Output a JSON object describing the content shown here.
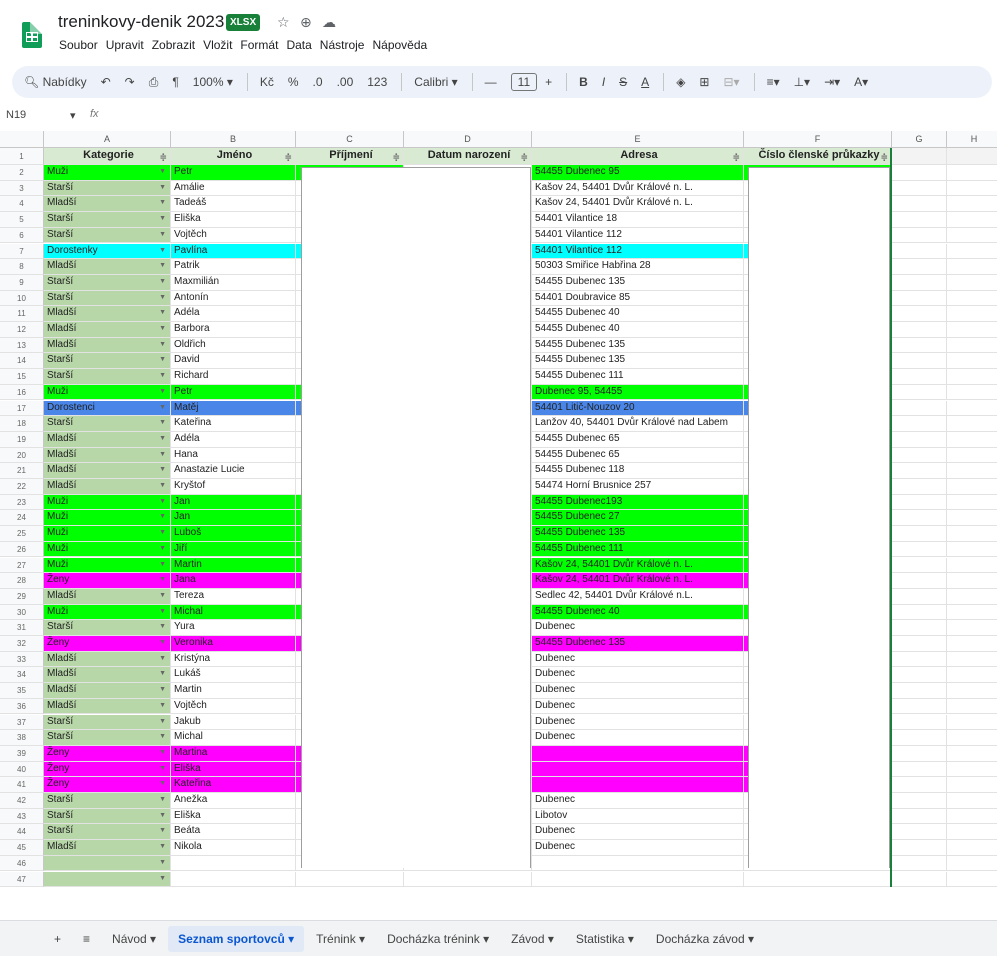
{
  "doc": {
    "title": "treninkovy-denik 2023",
    "badge": "XLSX",
    "menu": [
      "Soubor",
      "Upravit",
      "Zobrazit",
      "Vložit",
      "Formát",
      "Data",
      "Nástroje",
      "Nápověda"
    ]
  },
  "toolbar": {
    "search": "Nabídky",
    "zoom": "100% ▾",
    "currency": "Kč",
    "percent": "%",
    "dec_down": ".0",
    "dec_up": ".00",
    "num": "123",
    "font": "Calibri ▾",
    "minus": "—",
    "font_size": "11",
    "plus": "+",
    "bold": "B",
    "italic": "I",
    "strike": "S",
    "text_color": "A"
  },
  "formula": {
    "namebox": "N19",
    "fx": "fx"
  },
  "columns": [
    {
      "id": "A",
      "w": 127
    },
    {
      "id": "B",
      "w": 125
    },
    {
      "id": "C",
      "w": 108
    },
    {
      "id": "D",
      "w": 128
    },
    {
      "id": "E",
      "w": 212
    },
    {
      "id": "F",
      "w": 148
    },
    {
      "id": "G",
      "w": 55
    },
    {
      "id": "H",
      "w": 55
    }
  ],
  "colors": {
    "green": "#00ff00",
    "cyan": "#00ffff",
    "magenta": "#ff00ff",
    "blue": "#4a86e8",
    "sage": "#b7d7a8",
    "header": "#d9ead3"
  },
  "headers": [
    "Kategorie",
    "Jméno",
    "Příjmení",
    "Datum narození",
    "Adresa",
    "Číslo členské průkazky"
  ],
  "rows": [
    {
      "n": "2",
      "cat": "Muži",
      "name": "Petr",
      "addr": "54455 Dubenec 95",
      "c": "green"
    },
    {
      "n": "3",
      "cat": "Starší",
      "name": "Amálie",
      "addr": "Kašov 24, 54401 Dvůr Králové n. L.",
      "c": ""
    },
    {
      "n": "4",
      "cat": "Mladší",
      "name": "Tadeáš",
      "addr": "Kašov 24, 54401 Dvůr Králové n. L.",
      "c": ""
    },
    {
      "n": "5",
      "cat": "Starší",
      "name": "Eliška",
      "addr": "54401 Vilantice 18",
      "c": ""
    },
    {
      "n": "6",
      "cat": "Starší",
      "name": "Vojtěch",
      "addr": "54401 Vilantice 112",
      "c": ""
    },
    {
      "n": "7",
      "cat": "Dorostenky",
      "name": "Pavlína",
      "addr": "54401 Vilantice 112",
      "c": "cyan"
    },
    {
      "n": "8",
      "cat": "Mladší",
      "name": "Patrik",
      "addr": "50303 Smiřice Habřina 28",
      "c": ""
    },
    {
      "n": "9",
      "cat": "Starší",
      "name": "Maxmilián",
      "addr": "54455 Dubenec 135",
      "c": ""
    },
    {
      "n": "10",
      "cat": "Starší",
      "name": "Antonín",
      "addr": "54401 Doubravice 85",
      "c": ""
    },
    {
      "n": "11",
      "cat": "Mladší",
      "name": "Adéla",
      "addr": "54455 Dubenec 40",
      "c": ""
    },
    {
      "n": "12",
      "cat": "Mladší",
      "name": "Barbora",
      "addr": "54455 Dubenec 40",
      "c": ""
    },
    {
      "n": "13",
      "cat": "Mladší",
      "name": "Oldřich",
      "addr": "54455 Dubenec 135",
      "c": ""
    },
    {
      "n": "14",
      "cat": "Starší",
      "name": "David",
      "addr": "54455 Dubenec 135",
      "c": ""
    },
    {
      "n": "15",
      "cat": "Starší",
      "name": "Richard",
      "addr": "54455 Dubenec 111",
      "c": ""
    },
    {
      "n": "16",
      "cat": "Muži",
      "name": "Petr",
      "addr": "Dubenec 95, 54455",
      "c": "green"
    },
    {
      "n": "17",
      "cat": "Dorostenci",
      "name": "Matěj",
      "addr": "54401 Litič-Nouzov 20",
      "c": "blue"
    },
    {
      "n": "18",
      "cat": "Starší",
      "name": "Kateřina",
      "addr": "Lanžov 40, 54401 Dvůr Králové nad Labem",
      "c": ""
    },
    {
      "n": "19",
      "cat": "Mladší",
      "name": "Adéla",
      "addr": "54455 Dubenec 65",
      "c": ""
    },
    {
      "n": "20",
      "cat": "Mladší",
      "name": "Hana",
      "addr": "54455 Dubenec 65",
      "c": ""
    },
    {
      "n": "21",
      "cat": "Mladší",
      "name": "Anastazie Lucie",
      "addr": "54455 Dubenec 118",
      "c": ""
    },
    {
      "n": "22",
      "cat": "Mladší",
      "name": "Kryštof",
      "addr": "54474 Horní Brusnice 257",
      "c": ""
    },
    {
      "n": "23",
      "cat": "Muži",
      "name": "Jan",
      "addr": "54455 Dubenec193",
      "c": "green"
    },
    {
      "n": "24",
      "cat": "Muži",
      "name": "Jan",
      "addr": "54455 Dubenec 27",
      "c": "green"
    },
    {
      "n": "25",
      "cat": "Muži",
      "name": "Luboš",
      "addr": "54455 Dubenec 135",
      "c": "green"
    },
    {
      "n": "26",
      "cat": "Muži",
      "name": "Jiří",
      "addr": "54455 Dubenec 111",
      "c": "green"
    },
    {
      "n": "27",
      "cat": "Muži",
      "name": "Martin",
      "addr": "Kašov 24, 54401 Dvůr Králové n. L.",
      "c": "green"
    },
    {
      "n": "28",
      "cat": "Ženy",
      "name": "Jana",
      "addr": "Kašov 24, 54401 Dvůr Králové n. L.",
      "c": "magenta"
    },
    {
      "n": "29",
      "cat": "Mladší",
      "name": "Tereza",
      "addr": "Sedlec 42, 54401 Dvůr Králové n.L.",
      "c": ""
    },
    {
      "n": "30",
      "cat": "Muži",
      "name": "Michal",
      "addr": "54455 Dubenec 40",
      "c": "green"
    },
    {
      "n": "31",
      "cat": "Starší",
      "name": "Yura",
      "addr": "Dubenec",
      "c": ""
    },
    {
      "n": "32",
      "cat": "Ženy",
      "name": "Veronika",
      "addr": "54455 Dubenec 135",
      "c": "magenta"
    },
    {
      "n": "33",
      "cat": "Mladší",
      "name": "Kristýna",
      "addr": "Dubenec",
      "c": ""
    },
    {
      "n": "34",
      "cat": "Mladší",
      "name": "Lukáš",
      "addr": "Dubenec",
      "c": ""
    },
    {
      "n": "35",
      "cat": "Mladší",
      "name": "Martin",
      "addr": "Dubenec",
      "c": ""
    },
    {
      "n": "36",
      "cat": "Mladší",
      "name": "Vojtěch",
      "addr": "Dubenec",
      "c": ""
    },
    {
      "n": "37",
      "cat": "Starší",
      "name": "Jakub",
      "addr": "Dubenec",
      "c": ""
    },
    {
      "n": "38",
      "cat": "Starší",
      "name": "Michal",
      "addr": "Dubenec",
      "c": ""
    },
    {
      "n": "39",
      "cat": "Ženy",
      "name": "Martina",
      "addr": "",
      "c": "magenta"
    },
    {
      "n": "40",
      "cat": "Ženy",
      "name": "Eliška",
      "addr": "",
      "c": "magenta"
    },
    {
      "n": "41",
      "cat": "Ženy",
      "name": "Kateřina",
      "addr": "",
      "c": "magenta"
    },
    {
      "n": "42",
      "cat": "Starší",
      "name": "Anežka",
      "addr": "Dubenec",
      "c": ""
    },
    {
      "n": "43",
      "cat": "Starší",
      "name": "Eliška",
      "addr": "Libotov",
      "c": ""
    },
    {
      "n": "44",
      "cat": "Starší",
      "name": "Beáta",
      "addr": "Dubenec",
      "c": ""
    },
    {
      "n": "45",
      "cat": "Mladší",
      "name": "Nikola",
      "addr": "Dubenec",
      "c": ""
    },
    {
      "n": "46",
      "cat": "",
      "name": "",
      "addr": "",
      "c": ""
    },
    {
      "n": "47",
      "cat": "",
      "name": "",
      "addr": "",
      "c": ""
    }
  ],
  "tabs": [
    {
      "label": "Návod ▾",
      "active": false
    },
    {
      "label": "Seznam sportovců ▾",
      "active": true
    },
    {
      "label": "Trénink ▾",
      "active": false
    },
    {
      "label": "Docházka trénink ▾",
      "active": false
    },
    {
      "label": "Závod ▾",
      "active": false
    },
    {
      "label": "Statistika ▾",
      "active": false
    },
    {
      "label": "Docházka závod ▾",
      "active": false
    }
  ]
}
